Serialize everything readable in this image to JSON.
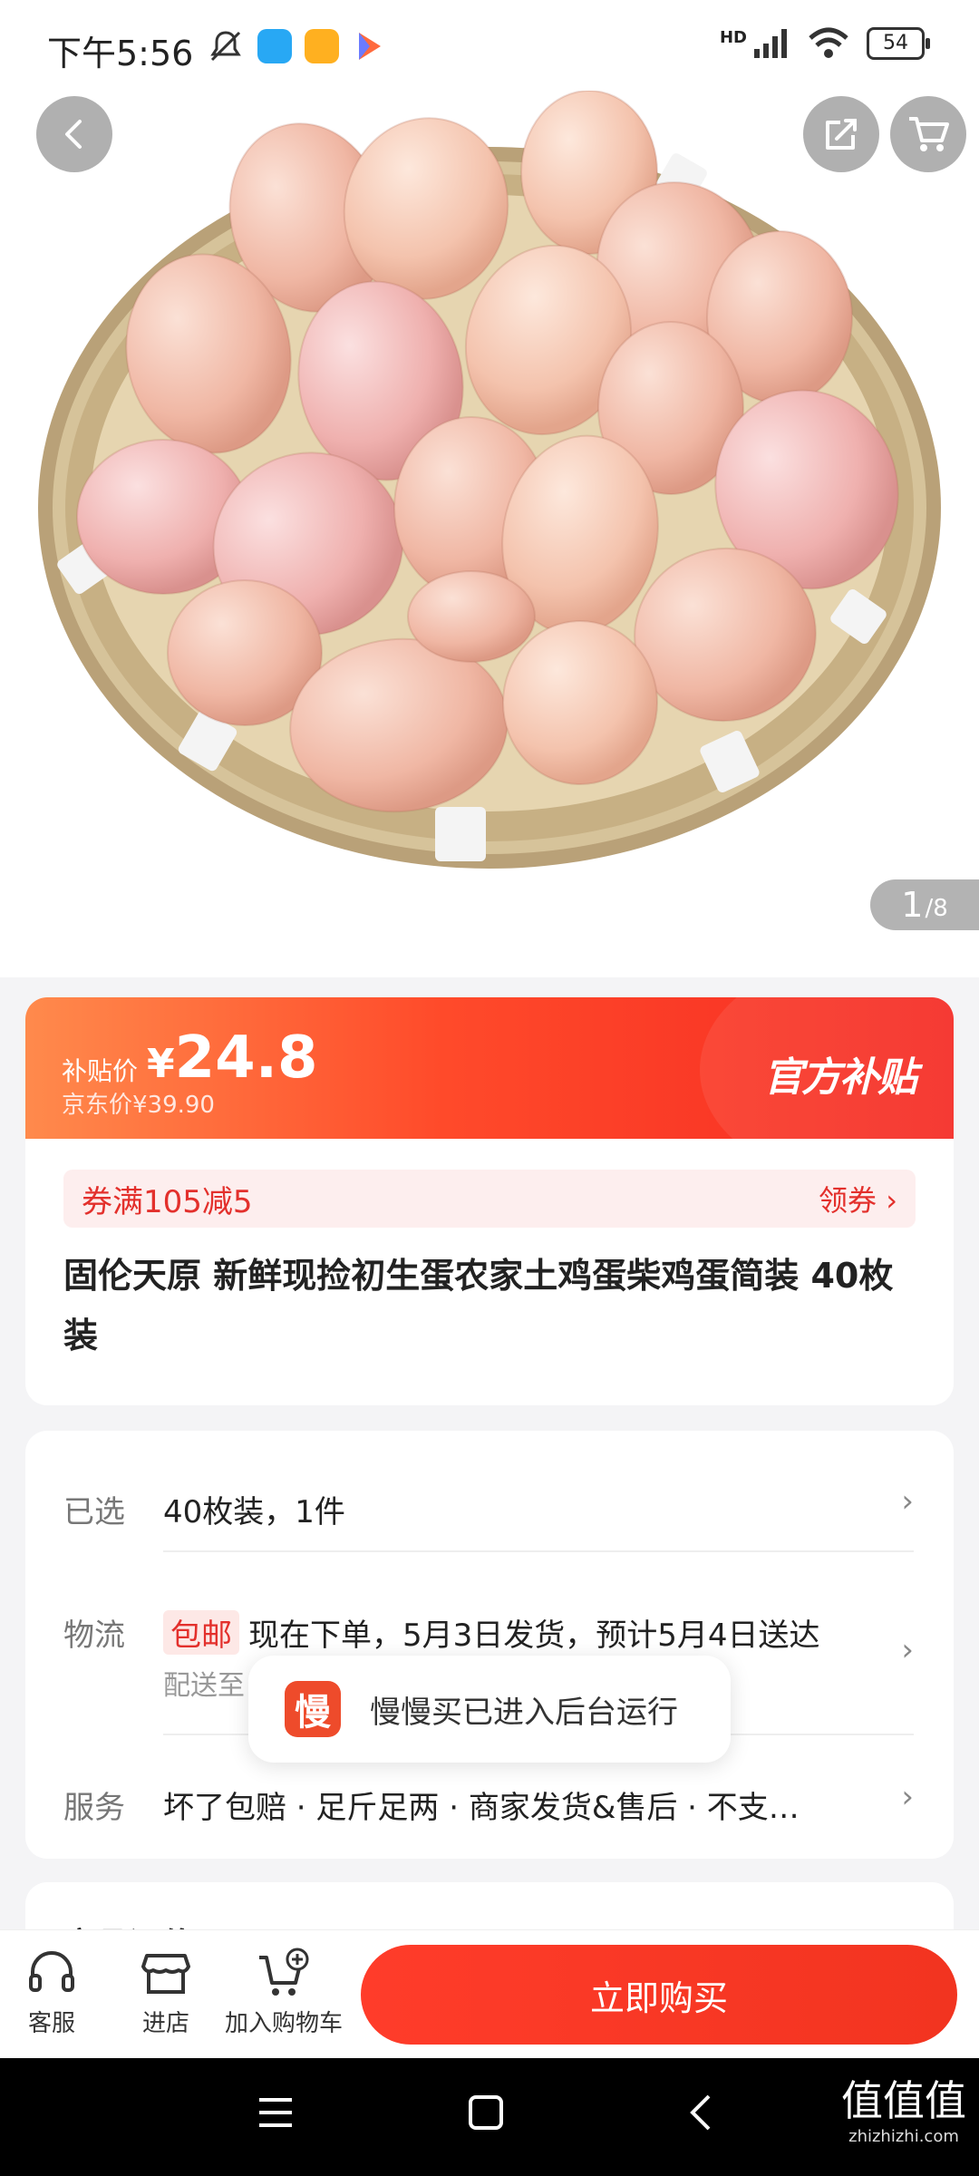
{
  "status_bar": {
    "time": "下午5:56",
    "network": "HD",
    "battery": "54"
  },
  "gallery": {
    "current": "1",
    "total": "/8",
    "image_alt": "product-eggs-in-basket"
  },
  "price_card": {
    "subsidy_label": "补贴价",
    "currency": "¥",
    "price": "24.8",
    "jd_price": "京东价¥39.90",
    "official_subsidy": "官方补贴",
    "coupon_text": "券满105减5",
    "coupon_claim": "领券 ›",
    "title": "固伦天原 新鲜现捡初生蛋农家土鸡蛋柴鸡蛋简装 40枚装"
  },
  "spec": {
    "selected_label": "已选",
    "selected_value": "40枚装，1件",
    "logistics_label": "物流",
    "free_shipping": "包邮",
    "logistics_value": "现在下单，5月3日发货，预计5月4日送达",
    "deliver_to": "配送至",
    "service_label": "服务",
    "service_value": "坏了包赔 · 足斤足两 · 商家发货&售后 · 不支…"
  },
  "toast": {
    "icon_char": "慢",
    "text": "慢慢买已进入后台运行"
  },
  "peek": {
    "text": "商品评价"
  },
  "action_bar": {
    "service_label": "客服",
    "store_label": "进店",
    "cart_label": "加入购物车",
    "buy_label": "立即购买"
  },
  "watermark": {
    "main": "值值值",
    "sub": "zhizhizhi.com"
  },
  "colors": {
    "accent_red": "#f23420",
    "coupon_red": "#e3302c"
  }
}
